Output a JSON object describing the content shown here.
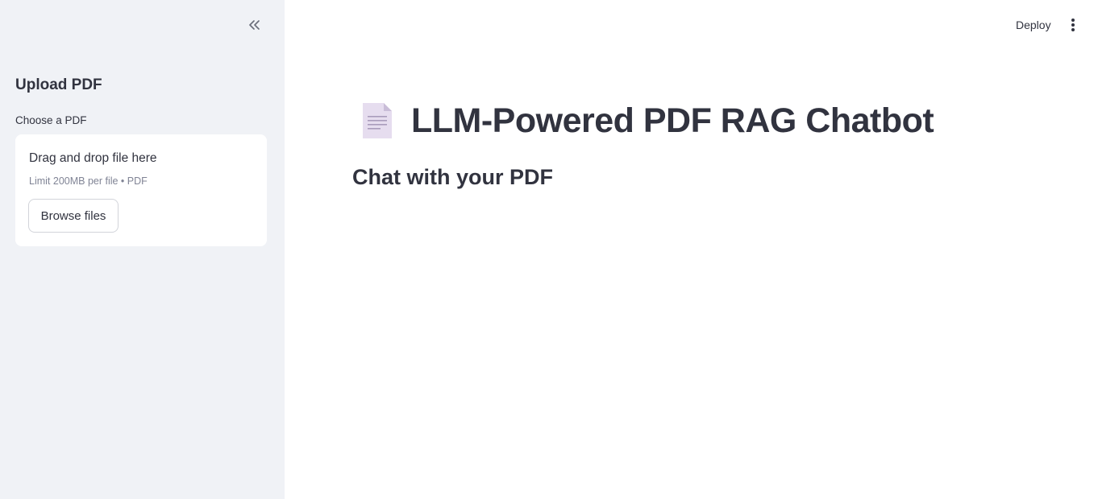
{
  "sidebar": {
    "collapse_icon": "double-chevron-left-icon",
    "title": "Upload PDF",
    "uploader": {
      "label": "Choose a PDF",
      "drop_text": "Drag and drop file here",
      "limit_text": "Limit 200MB per file • PDF",
      "browse_label": "Browse files"
    }
  },
  "header": {
    "deploy_label": "Deploy",
    "menu_icon": "vertical-dots-icon"
  },
  "main": {
    "title_icon": "page-icon",
    "title": "LLM-Powered PDF RAG Chatbot",
    "subheader": "Chat with your PDF"
  },
  "colors": {
    "sidebar_bg": "#f0f2f6",
    "text": "#31333f",
    "muted": "#808495",
    "border": "#d2d4da"
  }
}
